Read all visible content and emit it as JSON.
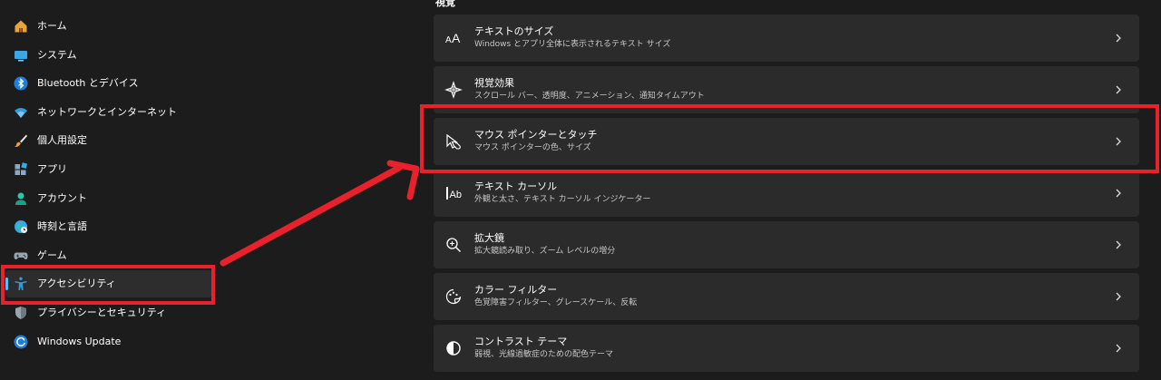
{
  "sidebar": {
    "items": [
      {
        "label": "ホーム",
        "icon": "home-icon"
      },
      {
        "label": "システム",
        "icon": "system-icon"
      },
      {
        "label": "Bluetooth とデバイス",
        "icon": "bluetooth-icon"
      },
      {
        "label": "ネットワークとインターネット",
        "icon": "wifi-icon"
      },
      {
        "label": "個人用設定",
        "icon": "brush-icon"
      },
      {
        "label": "アプリ",
        "icon": "apps-icon"
      },
      {
        "label": "アカウント",
        "icon": "account-icon"
      },
      {
        "label": "時刻と言語",
        "icon": "globe-icon"
      },
      {
        "label": "ゲーム",
        "icon": "gamepad-icon"
      },
      {
        "label": "アクセシビリティ",
        "icon": "accessibility-icon",
        "active": true
      },
      {
        "label": "プライバシーとセキュリティ",
        "icon": "shield-icon"
      },
      {
        "label": "Windows Update",
        "icon": "update-icon"
      }
    ]
  },
  "content": {
    "section_heading": "視覚",
    "cards": [
      {
        "title": "テキストのサイズ",
        "subtitle": "Windows とアプリ全体に表示されるテキスト サイズ",
        "icon": "text-size-icon"
      },
      {
        "title": "視覚効果",
        "subtitle": "スクロール バー、透明度、アニメーション、通知タイムアウト",
        "icon": "visual-effects-icon"
      },
      {
        "title": "マウス ポインターとタッチ",
        "subtitle": "マウス ポインターの色、サイズ",
        "icon": "mouse-pointer-icon"
      },
      {
        "title": "テキスト カーソル",
        "subtitle": "外観と太さ、テキスト カーソル インジケーター",
        "icon": "text-cursor-icon"
      },
      {
        "title": "拡大鏡",
        "subtitle": "拡大鏡読み取り、ズーム レベルの増分",
        "icon": "magnifier-icon"
      },
      {
        "title": "カラー フィルター",
        "subtitle": "色覚障害フィルター、グレースケール、反転",
        "icon": "color-filter-icon"
      },
      {
        "title": "コントラスト テーマ",
        "subtitle": "弱視、光線過敏症のための配色テーマ",
        "icon": "contrast-icon"
      }
    ]
  },
  "colors": {
    "background": "#1c1c1c",
    "card": "#2b2b2b",
    "accent": "#4cc2ff",
    "annotation": "#e8212c"
  }
}
